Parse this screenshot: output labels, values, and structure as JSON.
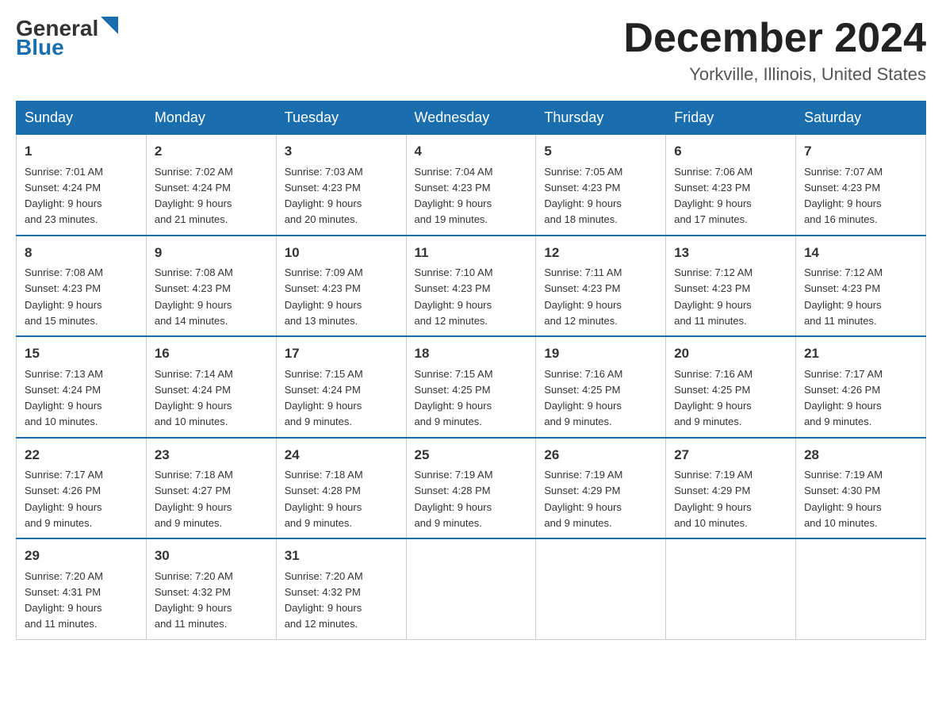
{
  "header": {
    "logo_line1": "General",
    "logo_line2": "Blue",
    "month_title": "December 2024",
    "location": "Yorkville, Illinois, United States"
  },
  "weekdays": [
    "Sunday",
    "Monday",
    "Tuesday",
    "Wednesday",
    "Thursday",
    "Friday",
    "Saturday"
  ],
  "weeks": [
    [
      {
        "day": "1",
        "sunrise": "7:01 AM",
        "sunset": "4:24 PM",
        "daylight": "9 hours and 23 minutes."
      },
      {
        "day": "2",
        "sunrise": "7:02 AM",
        "sunset": "4:24 PM",
        "daylight": "9 hours and 21 minutes."
      },
      {
        "day": "3",
        "sunrise": "7:03 AM",
        "sunset": "4:23 PM",
        "daylight": "9 hours and 20 minutes."
      },
      {
        "day": "4",
        "sunrise": "7:04 AM",
        "sunset": "4:23 PM",
        "daylight": "9 hours and 19 minutes."
      },
      {
        "day": "5",
        "sunrise": "7:05 AM",
        "sunset": "4:23 PM",
        "daylight": "9 hours and 18 minutes."
      },
      {
        "day": "6",
        "sunrise": "7:06 AM",
        "sunset": "4:23 PM",
        "daylight": "9 hours and 17 minutes."
      },
      {
        "day": "7",
        "sunrise": "7:07 AM",
        "sunset": "4:23 PM",
        "daylight": "9 hours and 16 minutes."
      }
    ],
    [
      {
        "day": "8",
        "sunrise": "7:08 AM",
        "sunset": "4:23 PM",
        "daylight": "9 hours and 15 minutes."
      },
      {
        "day": "9",
        "sunrise": "7:08 AM",
        "sunset": "4:23 PM",
        "daylight": "9 hours and 14 minutes."
      },
      {
        "day": "10",
        "sunrise": "7:09 AM",
        "sunset": "4:23 PM",
        "daylight": "9 hours and 13 minutes."
      },
      {
        "day": "11",
        "sunrise": "7:10 AM",
        "sunset": "4:23 PM",
        "daylight": "9 hours and 12 minutes."
      },
      {
        "day": "12",
        "sunrise": "7:11 AM",
        "sunset": "4:23 PM",
        "daylight": "9 hours and 12 minutes."
      },
      {
        "day": "13",
        "sunrise": "7:12 AM",
        "sunset": "4:23 PM",
        "daylight": "9 hours and 11 minutes."
      },
      {
        "day": "14",
        "sunrise": "7:12 AM",
        "sunset": "4:23 PM",
        "daylight": "9 hours and 11 minutes."
      }
    ],
    [
      {
        "day": "15",
        "sunrise": "7:13 AM",
        "sunset": "4:24 PM",
        "daylight": "9 hours and 10 minutes."
      },
      {
        "day": "16",
        "sunrise": "7:14 AM",
        "sunset": "4:24 PM",
        "daylight": "9 hours and 10 minutes."
      },
      {
        "day": "17",
        "sunrise": "7:15 AM",
        "sunset": "4:24 PM",
        "daylight": "9 hours and 9 minutes."
      },
      {
        "day": "18",
        "sunrise": "7:15 AM",
        "sunset": "4:25 PM",
        "daylight": "9 hours and 9 minutes."
      },
      {
        "day": "19",
        "sunrise": "7:16 AM",
        "sunset": "4:25 PM",
        "daylight": "9 hours and 9 minutes."
      },
      {
        "day": "20",
        "sunrise": "7:16 AM",
        "sunset": "4:25 PM",
        "daylight": "9 hours and 9 minutes."
      },
      {
        "day": "21",
        "sunrise": "7:17 AM",
        "sunset": "4:26 PM",
        "daylight": "9 hours and 9 minutes."
      }
    ],
    [
      {
        "day": "22",
        "sunrise": "7:17 AM",
        "sunset": "4:26 PM",
        "daylight": "9 hours and 9 minutes."
      },
      {
        "day": "23",
        "sunrise": "7:18 AM",
        "sunset": "4:27 PM",
        "daylight": "9 hours and 9 minutes."
      },
      {
        "day": "24",
        "sunrise": "7:18 AM",
        "sunset": "4:28 PM",
        "daylight": "9 hours and 9 minutes."
      },
      {
        "day": "25",
        "sunrise": "7:19 AM",
        "sunset": "4:28 PM",
        "daylight": "9 hours and 9 minutes."
      },
      {
        "day": "26",
        "sunrise": "7:19 AM",
        "sunset": "4:29 PM",
        "daylight": "9 hours and 9 minutes."
      },
      {
        "day": "27",
        "sunrise": "7:19 AM",
        "sunset": "4:29 PM",
        "daylight": "9 hours and 10 minutes."
      },
      {
        "day": "28",
        "sunrise": "7:19 AM",
        "sunset": "4:30 PM",
        "daylight": "9 hours and 10 minutes."
      }
    ],
    [
      {
        "day": "29",
        "sunrise": "7:20 AM",
        "sunset": "4:31 PM",
        "daylight": "9 hours and 11 minutes."
      },
      {
        "day": "30",
        "sunrise": "7:20 AM",
        "sunset": "4:32 PM",
        "daylight": "9 hours and 11 minutes."
      },
      {
        "day": "31",
        "sunrise": "7:20 AM",
        "sunset": "4:32 PM",
        "daylight": "9 hours and 12 minutes."
      },
      null,
      null,
      null,
      null
    ]
  ],
  "labels": {
    "sunrise": "Sunrise:",
    "sunset": "Sunset:",
    "daylight": "Daylight:"
  }
}
